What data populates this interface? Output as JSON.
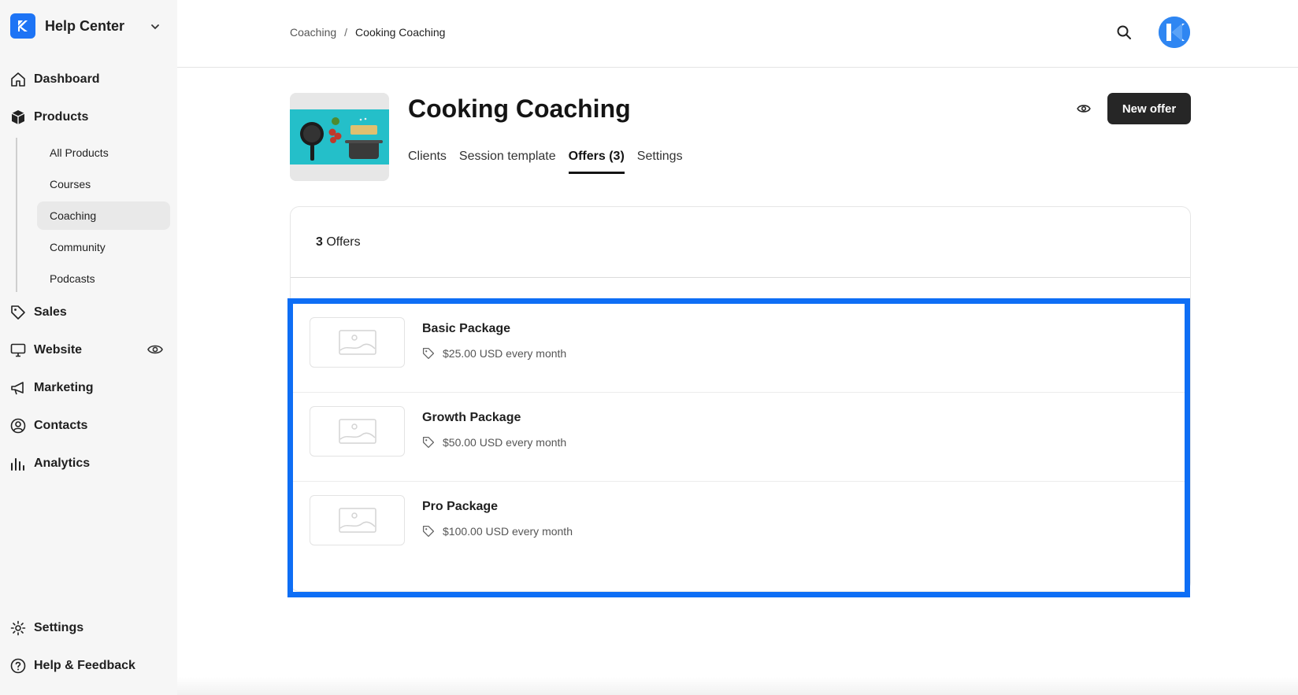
{
  "sidebar": {
    "brand_title": "Help Center",
    "nav": [
      {
        "label": "Dashboard",
        "icon": "home-icon"
      },
      {
        "label": "Products",
        "icon": "box-icon"
      },
      {
        "label": "Sales",
        "icon": "tag-icon"
      },
      {
        "label": "Website",
        "icon": "monitor-icon"
      },
      {
        "label": "Marketing",
        "icon": "megaphone-icon"
      },
      {
        "label": "Contacts",
        "icon": "user-circle-icon"
      },
      {
        "label": "Analytics",
        "icon": "bar-chart-icon"
      },
      {
        "label": "Settings",
        "icon": "gear-icon"
      },
      {
        "label": "Help & Feedback",
        "icon": "help-icon"
      }
    ],
    "products_sub": [
      {
        "label": "All Products"
      },
      {
        "label": "Courses"
      },
      {
        "label": "Coaching"
      },
      {
        "label": "Community"
      },
      {
        "label": "Podcasts"
      }
    ],
    "active_sub": "Coaching"
  },
  "breadcrumb": {
    "parent": "Coaching",
    "separator": "/",
    "current": "Cooking Coaching"
  },
  "product": {
    "title": "Cooking Coaching",
    "tabs": [
      {
        "label": "Clients"
      },
      {
        "label": "Session template"
      },
      {
        "label": "Offers (3)"
      },
      {
        "label": "Settings"
      }
    ],
    "active_tab": "Offers (3)",
    "new_offer_label": "New offer"
  },
  "offers": {
    "count": "3",
    "count_label": "Offers",
    "items": [
      {
        "name": "Basic Package",
        "price": "$25.00 USD every month"
      },
      {
        "name": "Growth Package",
        "price": "$50.00 USD every month"
      },
      {
        "name": "Pro Package",
        "price": "$100.00 USD every month"
      }
    ]
  },
  "colors": {
    "accent": "#0e6ef5",
    "brand": "#1d74f5",
    "button_dark": "#262626",
    "sidebar_bg": "#f6f6f6"
  }
}
